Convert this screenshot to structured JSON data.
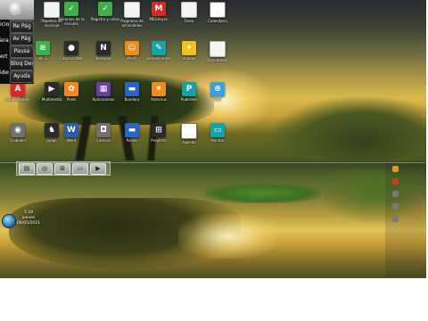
{
  "osk": {
    "left_labels": [
      "icio",
      "erar",
      "ert",
      "ides"
    ],
    "keys": [
      {
        "label": "Re Pág"
      },
      {
        "label": "Av Pág"
      },
      {
        "label": "Pausa"
      },
      {
        "label": "Bloq Despl"
      },
      {
        "label": "Ayuda"
      }
    ]
  },
  "desktop": {
    "icons": [
      {
        "name": "icon-papelera",
        "caption": "Papelera de reciclaje",
        "glyph": "",
        "style": "g-doc"
      },
      {
        "name": "icon-recursos",
        "caption": "Recursos de la escuela",
        "glyph": "✓",
        "style": "g-green"
      },
      {
        "name": "icon-doc-green",
        "caption": "Registro y notas",
        "glyph": "✓",
        "style": "g-green"
      },
      {
        "name": "icon-doc-1",
        "caption": "Programa de actividades",
        "glyph": "",
        "style": "g-doc"
      },
      {
        "name": "icon-mega",
        "caption": "MEGAsync",
        "glyph": "M",
        "style": "g-red"
      },
      {
        "name": "icon-doc-2",
        "caption": "Tarea",
        "glyph": "",
        "style": "g-doc"
      },
      {
        "name": "icon-calendar",
        "caption": "Calendario",
        "glyph": "31",
        "style": "g-cal"
      },
      {
        "name": "icon-wifi",
        "caption": "Wi-Fi",
        "glyph": "≋",
        "style": "g-green"
      },
      {
        "name": "icon-webcam",
        "caption": "Cámara Web",
        "glyph": "●",
        "style": "g-dark"
      },
      {
        "name": "icon-notepad",
        "caption": "Notepad",
        "glyph": "N",
        "style": "g-dark"
      },
      {
        "name": "icon-person",
        "caption": "Perfil",
        "glyph": "☺",
        "style": "g-orange"
      },
      {
        "name": "icon-toolbox",
        "caption": "Herramientas",
        "glyph": "✎",
        "style": "g-teal"
      },
      {
        "name": "icon-tool",
        "caption": "Utilidad",
        "glyph": "✦",
        "style": "g-yellow"
      },
      {
        "name": "icon-doc-3",
        "caption": "Documento",
        "glyph": "",
        "style": "g-doc"
      },
      {
        "name": "icon-pdf",
        "caption": "Adobe Reader",
        "glyph": "A",
        "style": "g-red"
      },
      {
        "name": "icon-media",
        "caption": "Multimedia",
        "glyph": "▶",
        "style": "g-dark"
      },
      {
        "name": "icon-paint",
        "caption": "Paint",
        "glyph": "✿",
        "style": "g-orange"
      },
      {
        "name": "icon-grid",
        "caption": "Aplicaciones",
        "glyph": "▦",
        "style": "g-purple"
      },
      {
        "name": "icon-flag",
        "caption": "Bandera",
        "glyph": "▬",
        "style": "g-blue"
      },
      {
        "name": "icon-avast",
        "caption": "Antivirus",
        "glyph": "✷",
        "style": "g-orange"
      },
      {
        "name": "icon-publisher",
        "caption": "Publisher",
        "glyph": "P",
        "style": "g-teal"
      },
      {
        "name": "icon-network",
        "caption": "Red",
        "glyph": "⊕",
        "style": "g-lightblue"
      },
      {
        "name": "icon-cd",
        "caption": "Grabador",
        "glyph": "◉",
        "style": "g-gray"
      },
      {
        "name": "icon-chess",
        "caption": "Juego",
        "glyph": "♞",
        "style": "g-dark"
      },
      {
        "name": "icon-word",
        "caption": "Word",
        "glyph": "W",
        "style": "g-word"
      },
      {
        "name": "icon-camera",
        "caption": "Cámara",
        "glyph": "◘",
        "style": "g-gray"
      },
      {
        "name": "icon-flag-2",
        "caption": "Países",
        "glyph": "▬",
        "style": "g-blue"
      },
      {
        "name": "icon-project",
        "caption": "Proyecto",
        "glyph": "⊞",
        "style": "g-dark"
      },
      {
        "name": "icon-calendar-2",
        "caption": "Agenda",
        "glyph": "31",
        "style": "g-cal"
      },
      {
        "name": "icon-monitor",
        "caption": "Monitor",
        "glyph": "▭",
        "style": "g-teal"
      }
    ]
  },
  "taskbar": {
    "buttons": [
      {
        "name": "taskbar-folder",
        "glyph": "▤"
      },
      {
        "name": "taskbar-chrome",
        "glyph": "◎"
      },
      {
        "name": "taskbar-network",
        "glyph": "⊞"
      },
      {
        "name": "taskbar-computer",
        "glyph": "▭"
      },
      {
        "name": "taskbar-pdf",
        "glyph": "▶"
      }
    ]
  },
  "tray": {
    "clock_time": "5:18",
    "clock_day": "jueves",
    "clock_date": "06/05/2021"
  }
}
